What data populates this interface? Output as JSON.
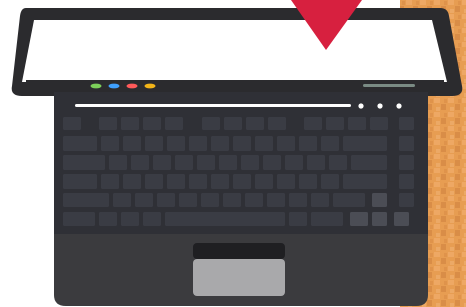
{
  "colors": {
    "page_background": "#ffffff",
    "wood_base": "#e79d52",
    "wood_dark": "#c97a3a",
    "wood_light": "#f3b072",
    "laptop_lid": "#2b2b2e",
    "screen": "#ffffff",
    "keyboard_deck": "#2f3036",
    "key": "#3a3c44",
    "key_light": "#4b4d55",
    "palmrest": "#3b3b3e",
    "touchpad_bar": "#1f1f22",
    "touchpad": "#a9a9ab",
    "marker": "#d7203f",
    "speaker_line": "#ffffff"
  },
  "taskbar_dots": [
    "#7ccf5a",
    "#3fa0ff",
    "#ff5a5a",
    "#f2b418"
  ],
  "icons": {
    "marker": "down-triangle-marker-icon",
    "status_dots": "three-dots-icon"
  }
}
